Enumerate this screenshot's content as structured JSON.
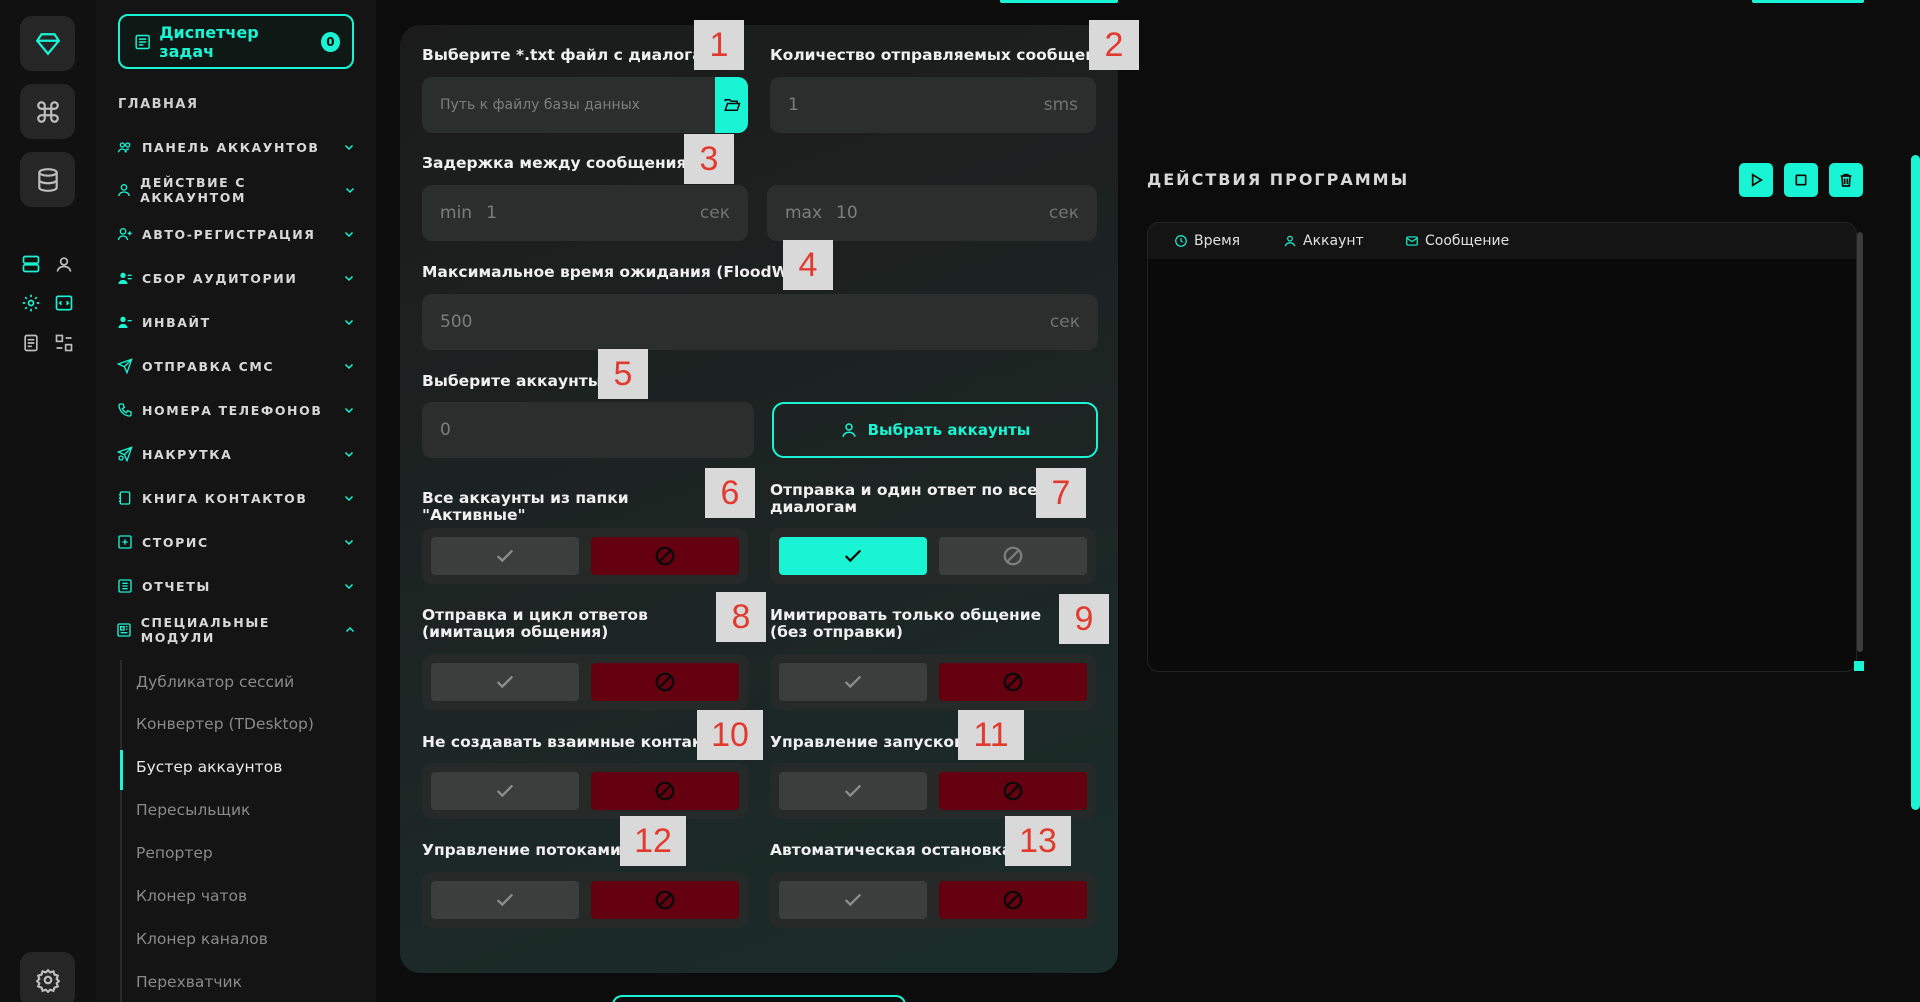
{
  "colors": {
    "accent": "#19f5d4",
    "danger": "#650010",
    "panel": "#1d2624"
  },
  "sidebar": {
    "task_manager": {
      "label": "Диспетчер задач",
      "count": "0"
    },
    "section_title": "ГЛАВНАЯ",
    "items": [
      {
        "label": "ПАНЕЛЬ АККАУНТОВ",
        "icon": "users-icon"
      },
      {
        "label": "ДЕЙСТВИЕ С АККАУНТОМ",
        "icon": "user-icon"
      },
      {
        "label": "АВТО-РЕГИСТРАЦИЯ",
        "icon": "user-plus-icon"
      },
      {
        "label": "СБОР АУДИТОРИИ",
        "icon": "audience-icon"
      },
      {
        "label": "ИНВАЙТ",
        "icon": "invite-icon"
      },
      {
        "label": "ОТПРАВКА СМС",
        "icon": "send-icon"
      },
      {
        "label": "НОМЕРА ТЕЛЕФОНОВ",
        "icon": "phone-icon"
      },
      {
        "label": "НАКРУТКА",
        "icon": "boost-icon"
      },
      {
        "label": "КНИГА КОНТАКТОВ",
        "icon": "book-icon"
      },
      {
        "label": "СТОРИС",
        "icon": "plus-square-icon"
      },
      {
        "label": "ОТЧЕТЫ",
        "icon": "report-icon"
      },
      {
        "label": "СПЕЦИАЛЬНЫЕ МОДУЛИ",
        "icon": "modules-icon"
      }
    ],
    "sub_items": [
      "Дубликатор сессий",
      "Конвертер (TDesktop)",
      "Бустер аккаунтов",
      "Пересыльщик",
      "Репортер",
      "Клонер чатов",
      "Клонер каналов",
      "Перехватчик"
    ]
  },
  "form": {
    "file_label": "Выберите *.txt файл с диалогами",
    "file_placeholder": "Путь к файлу базы данных",
    "count_label": "Количество отправляемых сообщений",
    "count_value": "1",
    "count_unit": "sms",
    "delay_label": "Задержка между сообщениями",
    "delay_min_prefix": "min",
    "delay_min_value": "1",
    "delay_max_prefix": "max",
    "delay_max_value": "10",
    "sec_unit": "сек",
    "flood_label": "Максимальное время ожидания (FloodWait)",
    "flood_value": "500",
    "accounts_label": "Выберите аккаунты",
    "accounts_value": "0",
    "select_accounts_button": "Выбрать аккаунты",
    "opt_active_folder": "Все аккаунты из папки \"Активные\"",
    "opt_send_one_reply": "Отправка и один ответ по всем диалогам",
    "opt_send_cycle": "Отправка и цикл ответов (имитация общения)",
    "opt_imitate_only": "Имитировать только общение (без отправки)",
    "opt_no_mutual": "Не создавать взаимные контакты",
    "opt_launch_control": "Управление запуском",
    "opt_threads": "Управление потоками",
    "opt_auto_stop": "Автоматическая остановка"
  },
  "markers": [
    "1",
    "2",
    "3",
    "4",
    "5",
    "6",
    "7",
    "8",
    "9",
    "10",
    "11",
    "12",
    "13"
  ],
  "log": {
    "title": "ДЕЙСТВИЯ ПРОГРАММЫ",
    "col_time": "Время",
    "col_account": "Аккаунт",
    "col_message": "Сообщение"
  }
}
